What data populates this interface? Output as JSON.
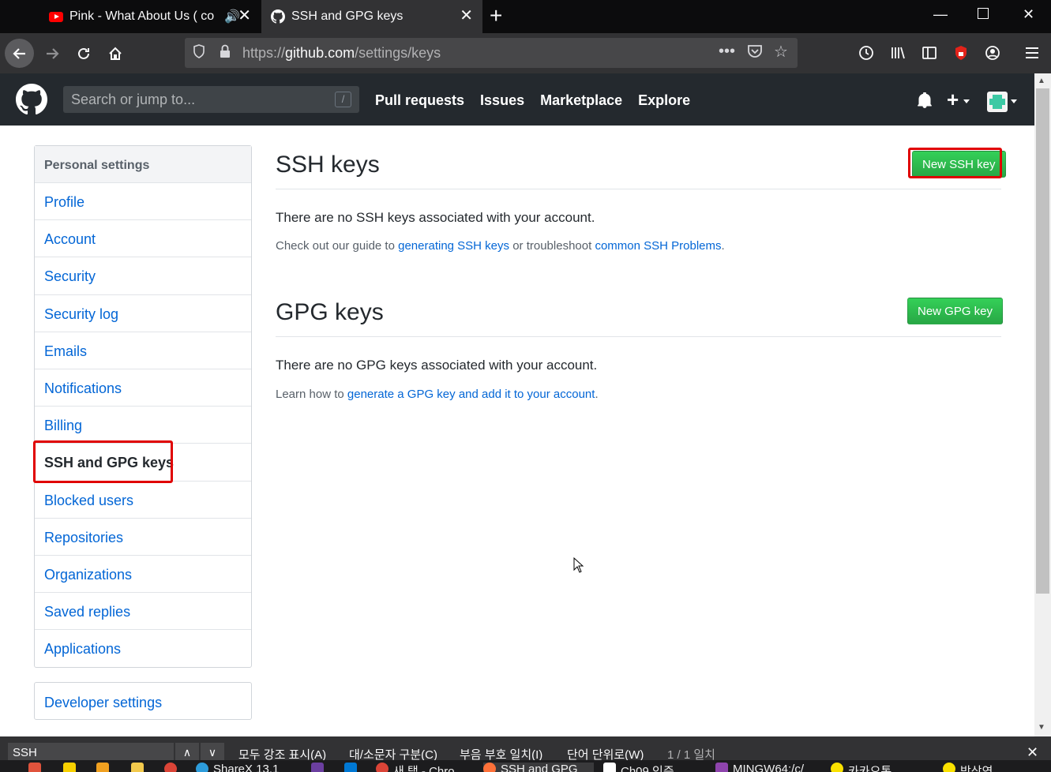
{
  "browser": {
    "tabs": [
      {
        "title": "Pink - What About Us ( co",
        "active": false,
        "icon": "youtube-icon"
      },
      {
        "title": "SSH and GPG keys",
        "active": true,
        "icon": "github-icon"
      }
    ],
    "url": {
      "scheme": "https://",
      "host": "github.com",
      "path": "/settings/keys"
    }
  },
  "github_header": {
    "search_placeholder": "Search or jump to...",
    "search_shortcut": "/",
    "nav": [
      "Pull requests",
      "Issues",
      "Marketplace",
      "Explore"
    ],
    "plus_label": "+"
  },
  "sidebar": {
    "heading": "Personal settings",
    "items": [
      {
        "label": "Profile"
      },
      {
        "label": "Account"
      },
      {
        "label": "Security"
      },
      {
        "label": "Security log"
      },
      {
        "label": "Emails"
      },
      {
        "label": "Notifications"
      },
      {
        "label": "Billing"
      },
      {
        "label": "SSH and GPG keys",
        "selected": true
      },
      {
        "label": "Blocked users"
      },
      {
        "label": "Repositories"
      },
      {
        "label": "Organizations"
      },
      {
        "label": "Saved replies"
      },
      {
        "label": "Applications"
      }
    ],
    "developer": "Developer settings"
  },
  "ssh": {
    "title": "SSH keys",
    "button": "New SSH key",
    "empty": "There are no SSH keys associated with your account.",
    "note_prefix": "Check out our guide to ",
    "link1": "generating SSH keys",
    "note_mid": " or troubleshoot ",
    "link2": "common SSH Problems",
    "note_suffix": "."
  },
  "gpg": {
    "title": "GPG keys",
    "button": "New GPG key",
    "empty": "There are no GPG keys associated with your account.",
    "note_prefix": "Learn how to ",
    "link": "generate a GPG key and add it to your account",
    "note_suffix": "."
  },
  "findbar": {
    "query": "SSH",
    "options": [
      "모두 강조 표시(A)",
      "대/소문자 구분(C)",
      "부음 부호 일치(I)",
      "단어 단위로(W)"
    ],
    "status": "1 / 1 일치"
  },
  "taskbar": {
    "items": [
      "ShareX 13.1",
      "새 탭 - Chro",
      "SSH and GPG",
      "Ch09 인증",
      "MINGW64:/c/",
      "카카오톡",
      "박상연"
    ]
  },
  "colors": {
    "github_header": "#24292e",
    "link": "#0366d6",
    "button_green": "#28a745",
    "highlight_red": "#e00000"
  }
}
